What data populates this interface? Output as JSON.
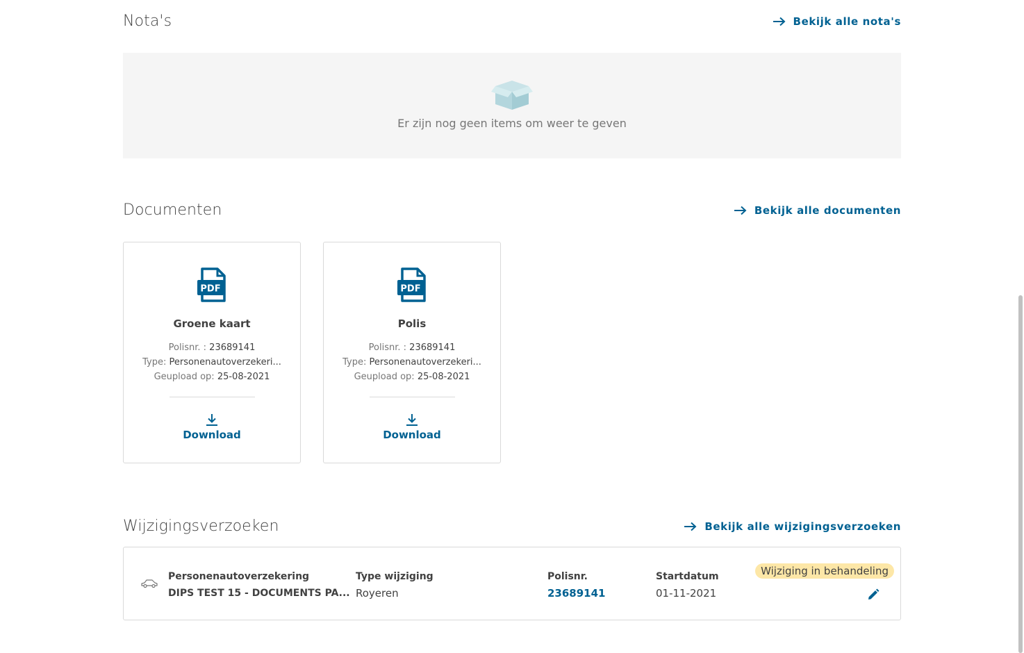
{
  "notas": {
    "title": "Nota's",
    "view_all": "Bekijk alle nota's",
    "empty_text": "Er zijn nog geen items om weer te geven"
  },
  "documenten": {
    "title": "Documenten",
    "view_all": "Bekijk alle documenten",
    "cards": [
      {
        "title": "Groene kaart",
        "polisnr_label": "Polisnr. :",
        "polisnr": "23689141",
        "type_label": "Type:",
        "type": "Personenautoverzekeri...",
        "uploaded_label": "Geupload op:",
        "uploaded": "25-08-2021",
        "download": "Download"
      },
      {
        "title": "Polis",
        "polisnr_label": "Polisnr. :",
        "polisnr": "23689141",
        "type_label": "Type:",
        "type": "Personenautoverzekeri...",
        "uploaded_label": "Geupload op:",
        "uploaded": "25-08-2021",
        "download": "Download"
      }
    ]
  },
  "wijzigingen": {
    "title": "Wijzigingsverzoeken",
    "view_all": "Bekijk alle wijzigingsverzoeken",
    "row": {
      "product": "Personenautoverzekering",
      "name": "DIPS TEST 15 - DOCUMENTS PA...",
      "type_header": "Type wijziging",
      "type_value": "Royeren",
      "polis_header": "Polisnr.",
      "polis_value": "23689141",
      "start_header": "Startdatum",
      "start_value": "01-11-2021",
      "status": "Wijziging in behandeling"
    }
  },
  "colors": {
    "accent": "#006192",
    "status_badge": "#fde7a7",
    "empty_bg": "#f5f5f5"
  },
  "icons": [
    "arrow-right-icon",
    "empty-box-icon",
    "pdf-icon",
    "download-icon",
    "car-icon",
    "pencil-icon"
  ]
}
